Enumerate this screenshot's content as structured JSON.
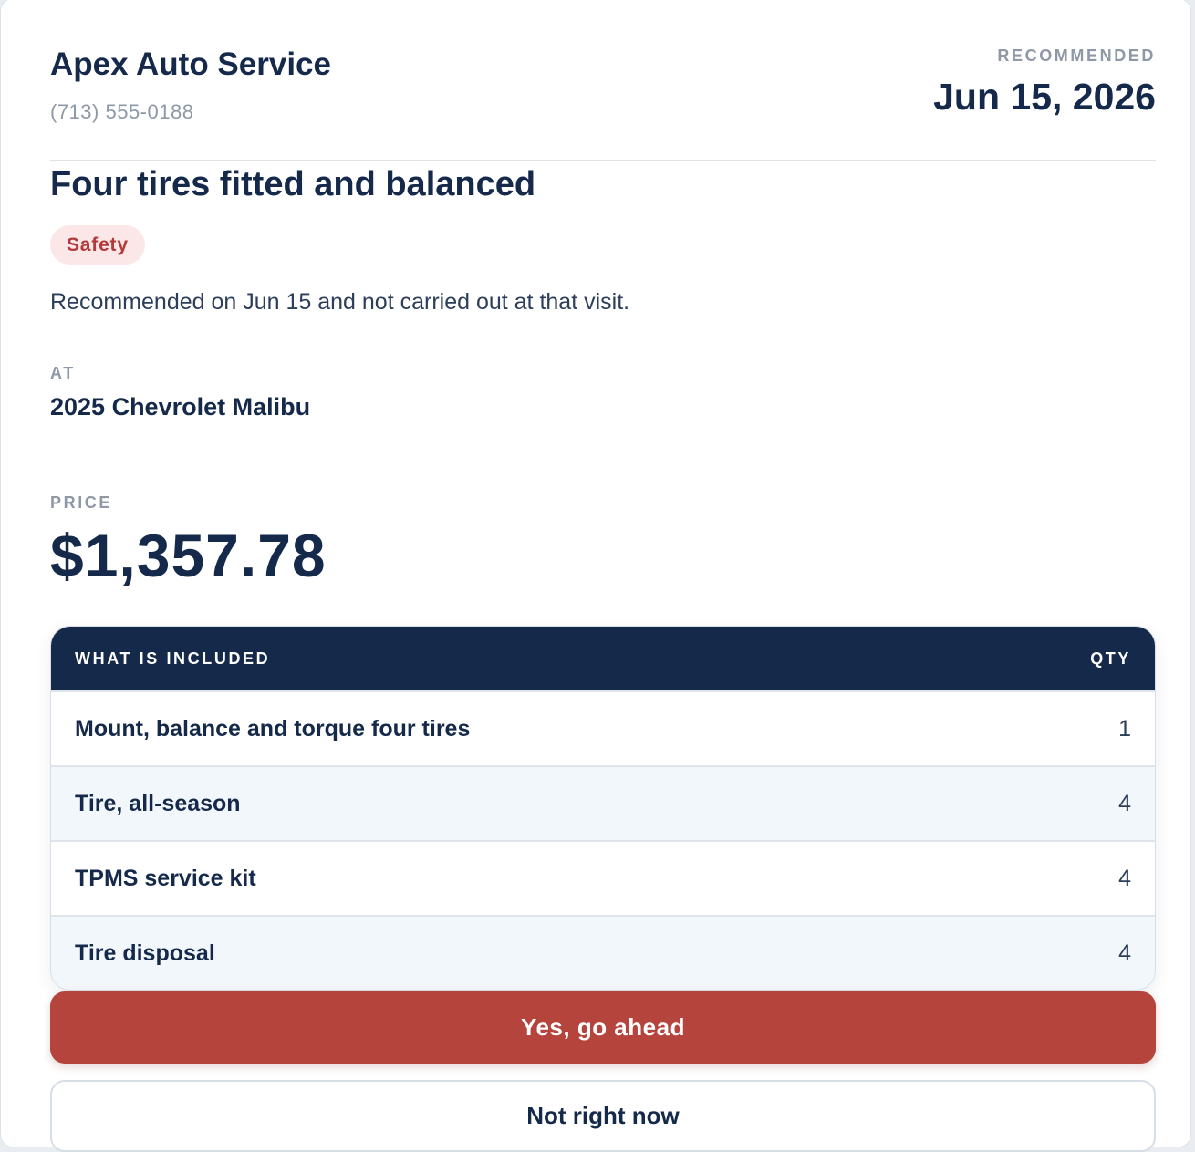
{
  "shop": {
    "name": "Apex Auto Service",
    "phone": "(713) 555-0188"
  },
  "recommendation": {
    "label": "RECOMMENDED",
    "date": "Jun 15, 2026"
  },
  "job": {
    "title": "Four tires fitted and balanced",
    "badge": "Safety",
    "badge_color": "#b33a3a",
    "note": "Recommended on Jun 15 and not carried out at that visit."
  },
  "vehicle": {
    "label": "AT",
    "name": "2025 Chevrolet Malibu"
  },
  "price": {
    "label": "PRICE",
    "amount": "$1,357.78"
  },
  "included": {
    "header_item": "WHAT IS INCLUDED",
    "header_qty": "QTY",
    "rows": [
      {
        "item": "Mount, balance and torque four tires",
        "qty": "1"
      },
      {
        "item": "Tire, all-season",
        "qty": "4"
      },
      {
        "item": "TPMS service kit",
        "qty": "4"
      },
      {
        "item": "Tire disposal",
        "qty": "4"
      }
    ]
  },
  "actions": {
    "approve_label": "Yes, go ahead",
    "decline_label": "Not right now",
    "approve_color": "#b5443d",
    "header_color": "#15294b"
  }
}
